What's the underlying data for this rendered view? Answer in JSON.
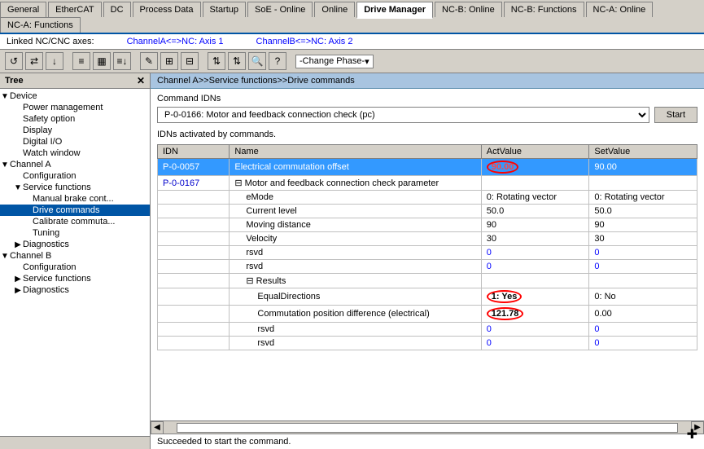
{
  "tabs": [
    {
      "label": "General",
      "active": false
    },
    {
      "label": "EtherCAT",
      "active": false
    },
    {
      "label": "DC",
      "active": false
    },
    {
      "label": "Process Data",
      "active": false
    },
    {
      "label": "Startup",
      "active": false
    },
    {
      "label": "SoE - Online",
      "active": false
    },
    {
      "label": "Online",
      "active": false
    },
    {
      "label": "Drive Manager",
      "active": true
    },
    {
      "label": "NC-B: Online",
      "active": false
    },
    {
      "label": "NC-B: Functions",
      "active": false
    },
    {
      "label": "NC-A: Online",
      "active": false
    },
    {
      "label": "NC-A: Functions",
      "active": false
    }
  ],
  "axes": {
    "channelA": "ChannelA<=>NC: Axis 1",
    "channelB": "ChannelB<=>NC: Axis 2"
  },
  "toolbar": {
    "dropdown_label": "-Change Phase-",
    "dropdown_arrow": "▾"
  },
  "sidebar": {
    "title": "Tree",
    "items": [
      {
        "id": "device",
        "label": "Device",
        "indent": 0,
        "expander": "▼",
        "selected": false
      },
      {
        "id": "power-management",
        "label": "Power management",
        "indent": 16,
        "expander": "",
        "selected": false
      },
      {
        "id": "safety-option",
        "label": "Safety option",
        "indent": 16,
        "expander": "",
        "selected": false
      },
      {
        "id": "display",
        "label": "Display",
        "indent": 16,
        "expander": "",
        "selected": false
      },
      {
        "id": "digital-io",
        "label": "Digital I/O",
        "indent": 16,
        "expander": "",
        "selected": false
      },
      {
        "id": "watch-window",
        "label": "Watch window",
        "indent": 16,
        "expander": "",
        "selected": false
      },
      {
        "id": "channel-a",
        "label": "Channel A",
        "indent": 0,
        "expander": "▼",
        "selected": false
      },
      {
        "id": "configuration",
        "label": "Configuration",
        "indent": 16,
        "expander": "",
        "selected": false
      },
      {
        "id": "service-functions",
        "label": "Service functions",
        "indent": 16,
        "expander": "▼",
        "selected": false
      },
      {
        "id": "manual-brake",
        "label": "Manual brake cont...",
        "indent": 28,
        "expander": "",
        "selected": false
      },
      {
        "id": "drive-commands",
        "label": "Drive commands",
        "indent": 28,
        "expander": "",
        "selected": true
      },
      {
        "id": "calibrate-commuta",
        "label": "Calibrate commuta...",
        "indent": 28,
        "expander": "",
        "selected": false
      },
      {
        "id": "tuning",
        "label": "Tuning",
        "indent": 28,
        "expander": "",
        "selected": false
      },
      {
        "id": "diagnostics",
        "label": "Diagnostics",
        "indent": 16,
        "expander": "▶",
        "selected": false
      },
      {
        "id": "channel-b",
        "label": "Channel B",
        "indent": 0,
        "expander": "▼",
        "selected": false
      },
      {
        "id": "configuration-b",
        "label": "Configuration",
        "indent": 16,
        "expander": "",
        "selected": false
      },
      {
        "id": "service-functions-b",
        "label": "Service functions",
        "indent": 16,
        "expander": "▶",
        "selected": false
      },
      {
        "id": "diagnostics-b",
        "label": "Diagnostics",
        "indent": 16,
        "expander": "▶",
        "selected": false
      }
    ]
  },
  "content": {
    "breadcrumb": "Channel A>>Service functions>>Drive commands",
    "section_label": "Command IDNs",
    "command_select": "P-0-0166: Motor and feedback connection check (pc)",
    "start_btn": "Start",
    "idn_note": "IDNs activated by commands.",
    "table": {
      "headers": [
        "IDN",
        "Name",
        "ActValue",
        "SetValue"
      ],
      "rows": [
        {
          "idn": "P-0-0057",
          "name": "Electrical commutation offset",
          "act_value": "90.00",
          "set_value": "90.00",
          "selected": true,
          "act_circle": true,
          "set_circle": false,
          "indent": 0,
          "is_parent": false
        },
        {
          "idn": "P-0-0167",
          "name": "Motor and feedback connection check parameter",
          "act_value": "",
          "set_value": "",
          "selected": false,
          "act_circle": false,
          "set_circle": false,
          "indent": 0,
          "is_parent": true
        },
        {
          "idn": "",
          "name": "eMode",
          "act_value": "0: Rotating vector",
          "set_value": "0: Rotating vector",
          "selected": false,
          "indent": 1,
          "is_parent": false
        },
        {
          "idn": "",
          "name": "Current level",
          "act_value": "50.0",
          "set_value": "50.0",
          "selected": false,
          "indent": 1,
          "is_parent": false
        },
        {
          "idn": "",
          "name": "Moving distance",
          "act_value": "90",
          "set_value": "90",
          "selected": false,
          "indent": 1,
          "is_parent": false
        },
        {
          "idn": "",
          "name": "Velocity",
          "act_value": "30",
          "set_value": "30",
          "selected": false,
          "indent": 1,
          "is_parent": false
        },
        {
          "idn": "",
          "name": "rsvd",
          "act_value": "0",
          "set_value": "0",
          "selected": false,
          "indent": 1,
          "is_parent": false,
          "act_blue": true,
          "set_blue": true
        },
        {
          "idn": "",
          "name": "rsvd",
          "act_value": "0",
          "set_value": "0",
          "selected": false,
          "indent": 1,
          "is_parent": false,
          "act_blue": true,
          "set_blue": true
        },
        {
          "idn": "",
          "name": "Results",
          "act_value": "",
          "set_value": "",
          "selected": false,
          "indent": 1,
          "is_parent": true
        },
        {
          "idn": "",
          "name": "EqualDirections",
          "act_value": "1: Yes",
          "set_value": "0: No",
          "selected": false,
          "indent": 2,
          "is_parent": false,
          "act_circle": true,
          "set_circle": false
        },
        {
          "idn": "",
          "name": "Commutation position difference (electrical)",
          "act_value": "121.78",
          "set_value": "0.00",
          "selected": false,
          "indent": 2,
          "is_parent": false,
          "act_circle": true,
          "set_circle": false
        },
        {
          "idn": "",
          "name": "rsvd",
          "act_value": "0",
          "set_value": "0",
          "selected": false,
          "indent": 2,
          "is_parent": false,
          "act_blue": true,
          "set_blue": true
        },
        {
          "idn": "",
          "name": "rsvd",
          "act_value": "0",
          "set_value": "0",
          "selected": false,
          "indent": 2,
          "is_parent": false,
          "act_blue": true,
          "set_blue": true
        }
      ]
    }
  },
  "status": {
    "message": "Succeeded to start the command."
  }
}
